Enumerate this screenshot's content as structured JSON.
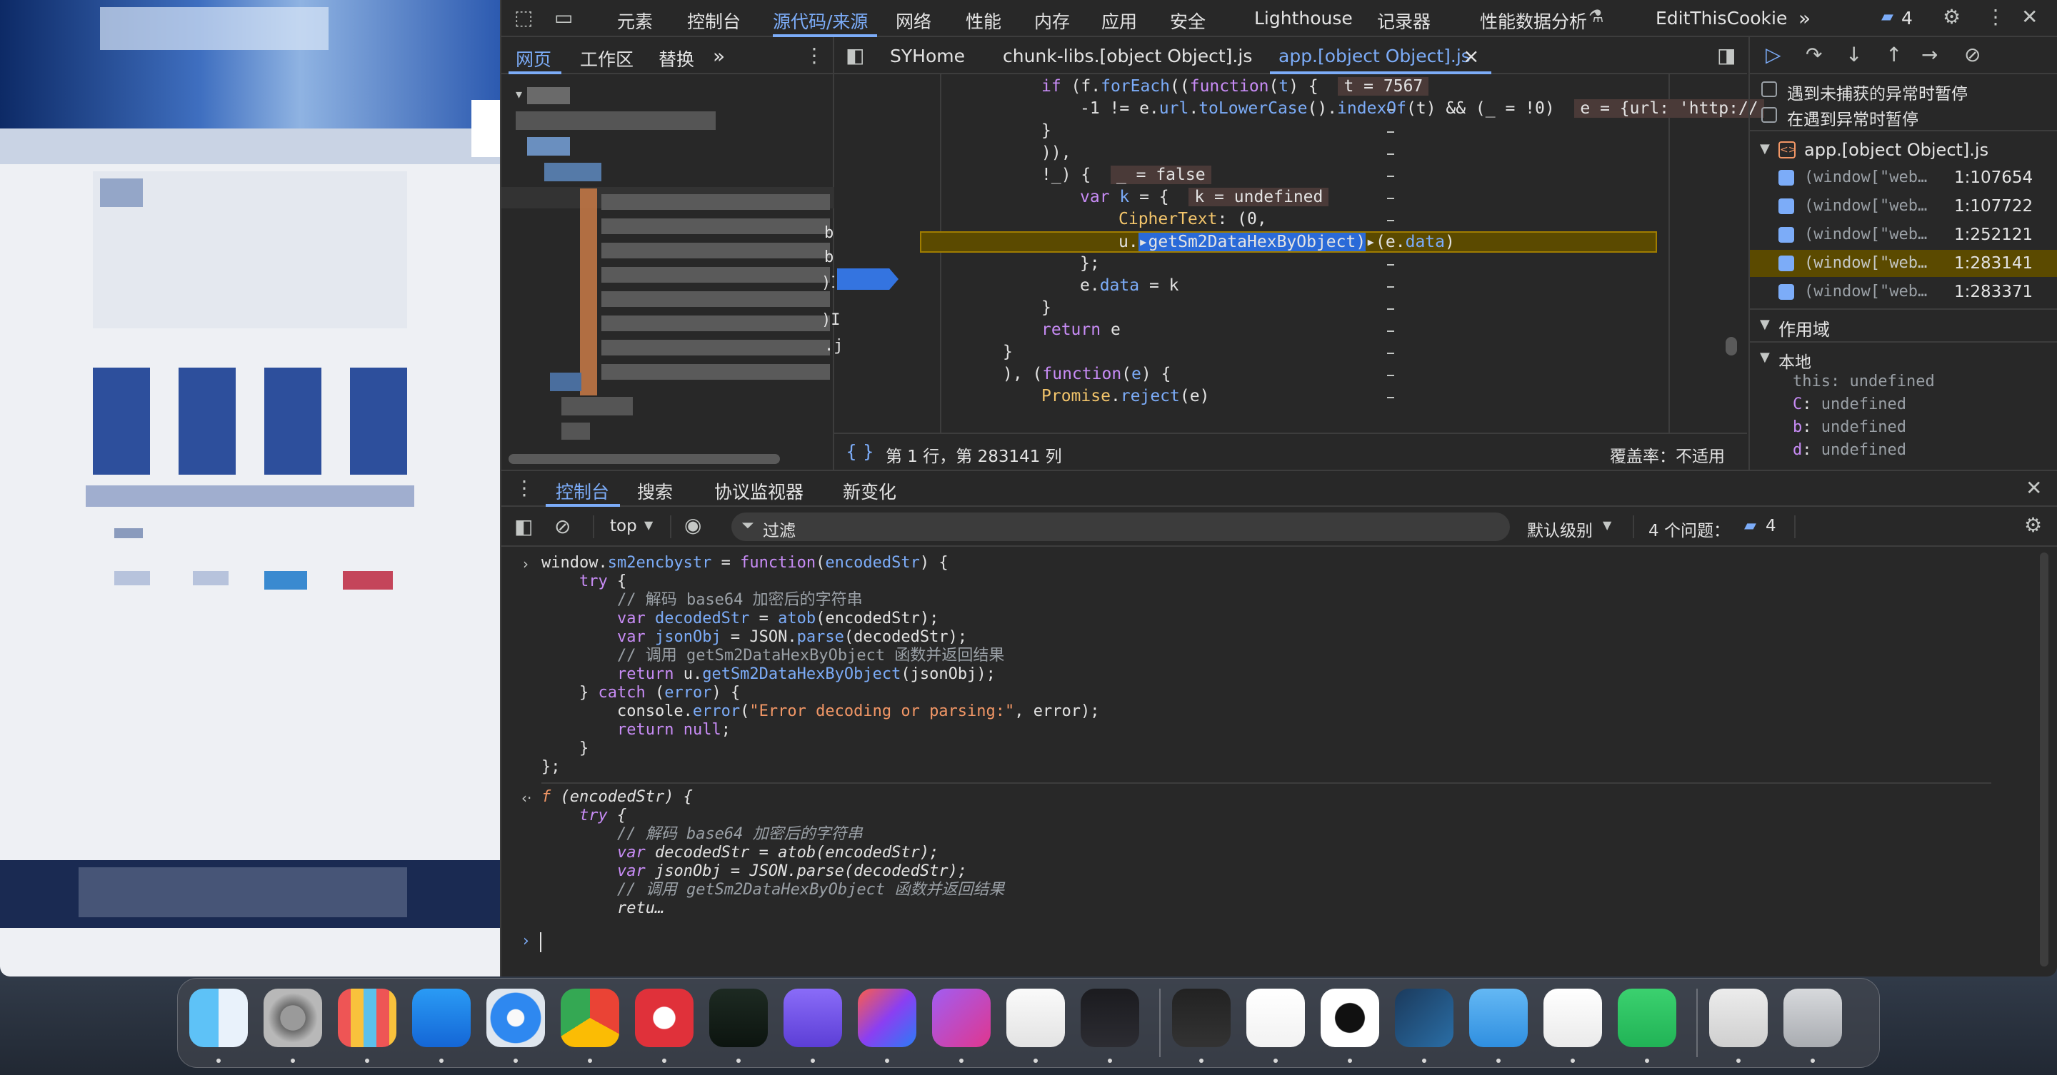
{
  "top_tabs": [
    "元素",
    "控制台",
    "源代码/来源",
    "网络",
    "性能",
    "内存",
    "应用",
    "安全",
    "Lighthouse",
    "记录器",
    "性能数据分析",
    "EditThisCookie"
  ],
  "top_selected": "源代码/来源",
  "top_more": "»",
  "issues_badge": "4",
  "nav_tabs": [
    "网页",
    "工作区",
    "替换"
  ],
  "nav_more": "»",
  "file_tabs": [
    "SYHome",
    "chunk-libs.[object Object].js",
    "app.[object Object].js"
  ],
  "file_tab_close": "×",
  "code_lines": [
    "if (f.forEach((function(t) {",
    "-1 != e.url.toLowerCase().indexOf(t) && (_ = !0)",
    "}",
    ")),",
    "!_) {",
    "var k = {",
    "CipherText: (0,",
    "u.getSm2DataHexByObject)(e.data)",
    "};",
    "e.data = k",
    "}",
    "return e",
    "}",
    "), (function(e) {",
    "Promise.reject(e)"
  ],
  "inline_values": [
    "t = 7567",
    "e = {url: 'http://",
    "_ = false",
    "k = undefined"
  ],
  "status_bar": {
    "position": "第 1 行，第 283141 列",
    "coverage": "覆盖率：不适用"
  },
  "breakpoint_options": [
    "遇到未捕获的异常时暂停",
    "在遇到异常时暂停"
  ],
  "bp_file": "app.[object Object].js",
  "breakpoints": [
    {
      "code": "(window[\"web…",
      "loc": "1:107654"
    },
    {
      "code": "(window[\"web…",
      "loc": "1:107722"
    },
    {
      "code": "(window[\"web…",
      "loc": "1:252121"
    },
    {
      "code": "(window[\"web…",
      "loc": "1:283141"
    },
    {
      "code": "(window[\"web…",
      "loc": "1:283371"
    }
  ],
  "scope_title": "作用域",
  "scope_local": "本地",
  "scope_vars": [
    {
      "name": "this",
      "value": "undefined"
    },
    {
      "name": "C",
      "value": "undefined"
    },
    {
      "name": "b",
      "value": "undefined"
    },
    {
      "name": "d",
      "value": "undefined"
    }
  ],
  "drawer_tabs": [
    "控制台",
    "搜索",
    "协议监视器",
    "新变化"
  ],
  "console_toolbar": {
    "context": "top",
    "filter_placeholder": "过滤",
    "level": "默认级别",
    "issues": "4 个问题：",
    "issues_count": "4"
  },
  "console_input": [
    "window.sm2encbystr = function(encodedStr) {",
    "    try {",
    "        // 解码 base64 加密后的字符串",
    "        var decodedStr = atob(encodedStr);",
    "        var jsonObj = JSON.parse(decodedStr);",
    "        // 调用 getSm2DataHexByObject 函数并返回结果",
    "        return u.getSm2DataHexByObject(jsonObj);",
    "    } catch (error) {",
    "        console.error(\"Error decoding or parsing:\", error);",
    "        return null;",
    "    }",
    "};"
  ],
  "console_output": [
    "f (encodedStr) {",
    "    try {",
    "        // 解码 base64 加密后的字符串",
    "        var decodedStr = atob(encodedStr);",
    "        var jsonObj = JSON.parse(decodedStr);",
    "        // 调用 getSm2DataHexByObject 函数并返回结果",
    "        retu…"
  ],
  "tree_partial_chars": [
    "b",
    "b",
    ")I",
    ")I",
    ".j"
  ],
  "dock_apps": [
    "finder-icon",
    "system-settings-icon",
    "launchpad-icon",
    "app-store-icon",
    "safari-icon",
    "chrome-icon",
    "netease-music-icon",
    "activity-monitor-icon",
    "reeder-icon",
    "intellij-icon",
    "phpstorm-icon",
    "typora-icon",
    "ollama-icon",
    "terminal-icon",
    "wps-icon",
    "qq-icon",
    "steam-icon",
    "folder-icon",
    "vscode-icon",
    "wechat-icon",
    "archive-icon",
    "trash-icon"
  ],
  "colors": {
    "accent": "#7cacf8",
    "panel": "#282828",
    "highlight": "#5b4a00"
  }
}
